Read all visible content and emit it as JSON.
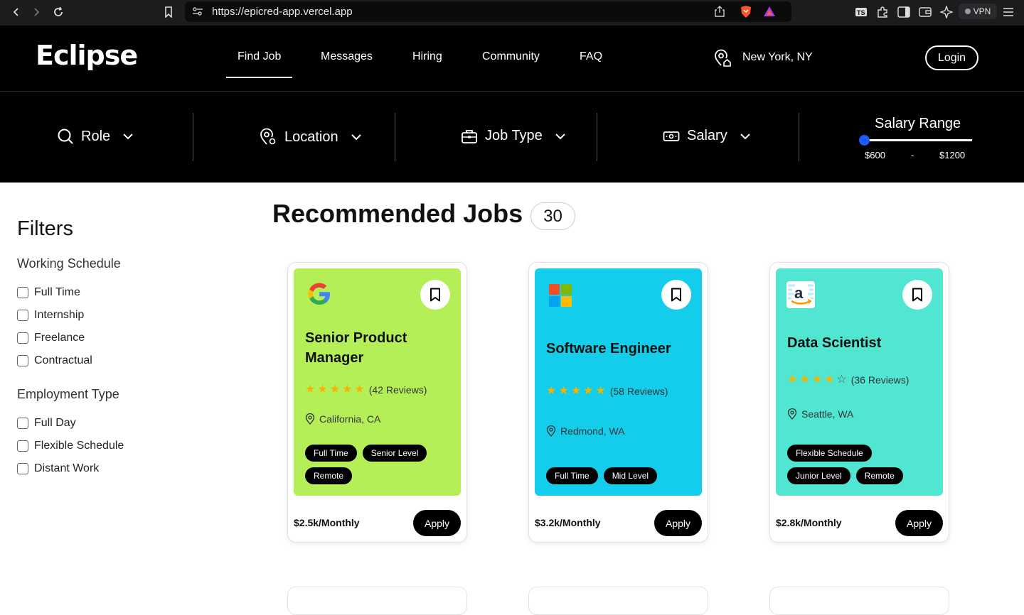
{
  "browser": {
    "url": "https://epicred-app.vercel.app",
    "vpn_label": "VPN"
  },
  "header": {
    "logo": "Eclipse",
    "nav": [
      "Find Job",
      "Messages",
      "Hiring",
      "Community",
      "FAQ"
    ],
    "active_nav": "Find Job",
    "location": "New York, NY",
    "login_label": "Login"
  },
  "searchbar": {
    "role_label": "Role",
    "location_label": "Location",
    "job_type_label": "Job Type",
    "salary_label": "Salary",
    "range_title": "Salary Range",
    "range_min": "$600",
    "range_sep": "-",
    "range_max": "$1200"
  },
  "filters": {
    "title": "Filters",
    "working_schedule_title": "Working Schedule",
    "working_schedule": [
      "Full Time",
      "Internship",
      "Freelance",
      "Contractual"
    ],
    "employment_type_title": "Employment Type",
    "employment_type": [
      "Full Day",
      "Flexible Schedule",
      "Distant Work"
    ]
  },
  "recommended": {
    "title": "Recommended Jobs",
    "count": "30"
  },
  "jobs": [
    {
      "company_icon": "google-logo",
      "title": "Senior Product Manager",
      "stars": 5,
      "reviews": "(42 Reviews)",
      "location": "California, CA",
      "tags": [
        "Full Time",
        "Senior Level",
        "Remote"
      ],
      "salary": "$2.5k/Monthly",
      "apply_label": "Apply",
      "bg_color": "#b5ef57"
    },
    {
      "company_icon": "microsoft-logo",
      "title": "Software Engineer",
      "stars": 5,
      "reviews": "(58 Reviews)",
      "location": "Redmond, WA",
      "tags": [
        "Full Time",
        "Mid Level"
      ],
      "salary": "$3.2k/Monthly",
      "apply_label": "Apply",
      "bg_color": "#13cdea"
    },
    {
      "company_icon": "amazon-logo",
      "title": "Data Scientist",
      "stars": 4,
      "reviews": "(36 Reviews)",
      "location": "Seattle, WA",
      "tags": [
        "Flexible Schedule",
        "Junior Level",
        "Remote"
      ],
      "salary": "$2.8k/Monthly",
      "apply_label": "Apply",
      "bg_color": "#50e6d2"
    }
  ]
}
